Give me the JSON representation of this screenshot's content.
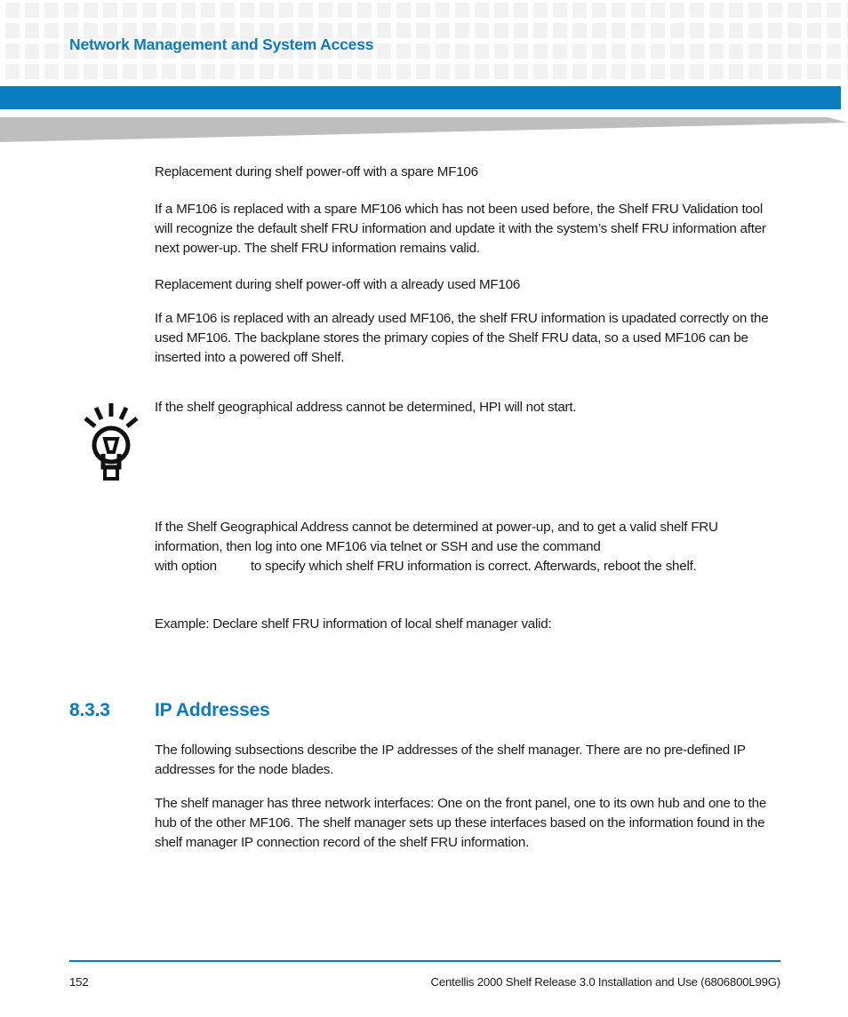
{
  "header": {
    "running_title": "Network Management and System Access",
    "accent_color": "#0d7ac0",
    "bar_color": "#0b7cbf",
    "wedge_color": "#bebebe",
    "pattern_cell_color": "#f2f2f2"
  },
  "body": {
    "paragraphs": [
      {
        "id": "p1",
        "text": "Replacement during shelf power-off with a spare MF106"
      },
      {
        "id": "p2",
        "text": "If a MF106 is replaced with a spare MF106 which has not been used before, the Shelf FRU Validation tool will recognize the default shelf FRU information and update it with the system’s shelf FRU information after next power-up. The shelf FRU information remains valid."
      },
      {
        "id": "p3",
        "text": "Replacement during shelf power-off with a already used MF106"
      },
      {
        "id": "p4",
        "text": "If a MF106 is replaced with an already used MF106, the shelf FRU information is upadated correctly on the used MF106. The backplane stores the primary copies of the Shelf FRU data, so a used MF106 can be inserted into a powered off Shelf."
      },
      {
        "id": "tip",
        "text": "If the shelf geographical address cannot be determined, HPI will not start."
      }
    ],
    "command_paragraph": {
      "lead": "If the Shelf Geographical Address cannot be determined at power-up, and to get a valid shelf FRU information, then log into one MF106 via telnet or SSH and use the command",
      "middle": "with option",
      "tail": "to specify which shelf FRU information is correct. Afterwards, reboot the shelf."
    },
    "example_line": "Example: Declare shelf FRU information of local shelf manager valid:"
  },
  "section": {
    "number": "8.3.3",
    "title": "IP Addresses",
    "paragraphs": [
      "The following subsections describe the IP addresses of the shelf manager. There are no pre-defined IP addresses for the node blades.",
      "The shelf manager has three network interfaces: One on the front panel, one to its own hub and one to the hub of the other MF106. The shelf manager sets up these interfaces based on the information found in the shelf manager IP connection record of the shelf FRU information."
    ]
  },
  "icons": {
    "tip_icon_name": "lightbulb-tip-icon"
  },
  "footer": {
    "page_number": "152",
    "document_title": "Centellis 2000 Shelf Release 3.0 Installation and Use (6806800L99G)"
  }
}
